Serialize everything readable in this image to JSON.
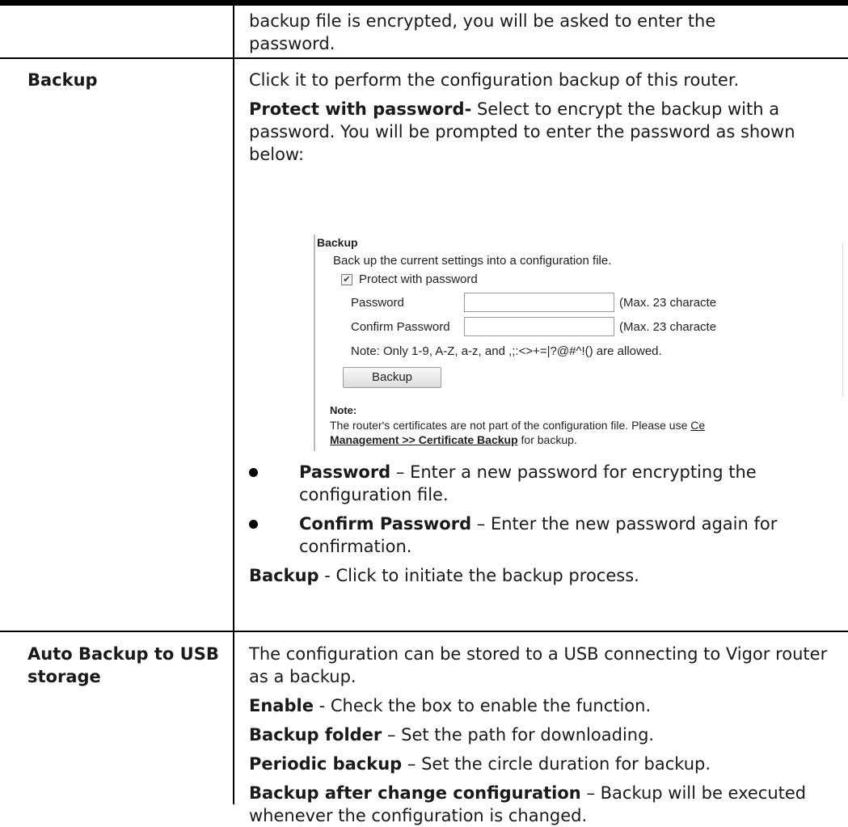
{
  "top_row": {
    "line1": "backup file is encrypted, you will be asked to enter the",
    "line2": "password."
  },
  "backup_row": {
    "label": "Backup",
    "intro": "Click it to perform the configuration backup of this router.",
    "protect_bold": "Protect with password-",
    "protect_text": " Select to encrypt the backup with a password. You will be prompted to enter the password as shown below:",
    "panel": {
      "title": "Backup",
      "description": "Back up the current settings into a configuration file.",
      "checkbox_label": "Protect with password",
      "password_label": "Password",
      "password_hint": "(Max. 23 characte",
      "confirm_label": "Confirm Password",
      "confirm_hint": "(Max. 23 characte",
      "allowed_note": "Note: Only 1-9, A-Z, a-z, and ,;:<>+=|?@#^!() are allowed.",
      "button_label": "Backup",
      "note_heading": "Note:",
      "note_text": "The router's certificates are not part of the configuration file. Please use ",
      "note_link_start": "Ce",
      "note_link_line2": "Management >> Certificate Backup",
      "note_tail": " for backup."
    },
    "bullets": [
      {
        "term": "Password",
        "text": " – Enter a new password for encrypting the configuration file."
      },
      {
        "term": "Confirm Password",
        "text": " – Enter the new password again for confirmation."
      }
    ],
    "backup_bold": "Backup",
    "backup_text": " - Click to initiate the backup process."
  },
  "usb_row": {
    "label_line1": "Auto Backup to USB",
    "label_line2": "storage",
    "intro": "The configuration can be stored to a USB connecting to Vigor router as a backup.",
    "items": [
      {
        "term": "Enable",
        "text": " - Check the box to enable the function."
      },
      {
        "term": "Backup folder",
        "text": " – Set the path for downloading."
      },
      {
        "term": "Periodic backup",
        "text": " – Set the circle duration for backup."
      },
      {
        "term": "Backup after change configuration",
        "text": " – Backup will be executed whenever the configuration is changed."
      }
    ]
  }
}
